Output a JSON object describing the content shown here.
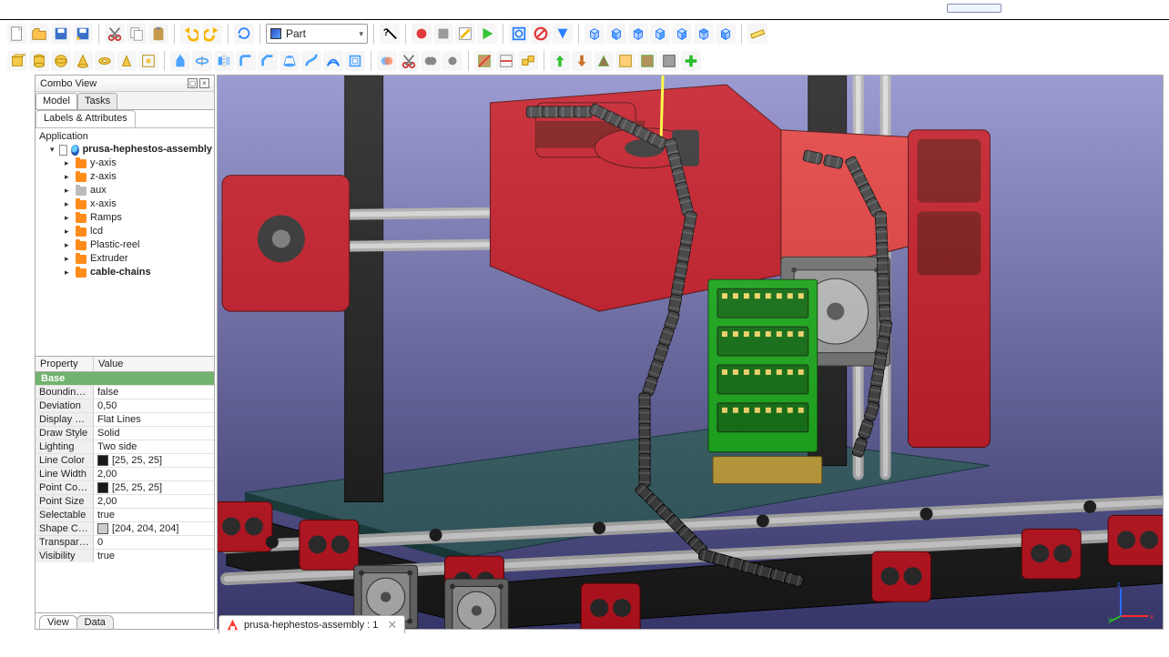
{
  "workbench": {
    "label": "Part"
  },
  "combo_view": {
    "title": "Combo View",
    "tabs": [
      {
        "label": "Model",
        "active": true
      },
      {
        "label": "Tasks",
        "active": false
      }
    ],
    "sub_tabs": [
      {
        "label": "Labels & Attributes",
        "active": true
      }
    ]
  },
  "tree": {
    "root": "Application",
    "document": "prusa-hephestos-assembly",
    "items": [
      {
        "label": "y-axis",
        "kind": "folder"
      },
      {
        "label": "z-axis",
        "kind": "folder"
      },
      {
        "label": "aux",
        "kind": "folder-gray"
      },
      {
        "label": "x-axis",
        "kind": "folder"
      },
      {
        "label": "Ramps",
        "kind": "folder"
      },
      {
        "label": "lcd",
        "kind": "folder"
      },
      {
        "label": "Plastic-reel",
        "kind": "folder"
      },
      {
        "label": "Extruder",
        "kind": "folder"
      },
      {
        "label": "cable-chains",
        "kind": "folder",
        "bold": true
      }
    ]
  },
  "props": {
    "headers": {
      "prop": "Property",
      "val": "Value"
    },
    "group": "Base",
    "rows": [
      {
        "k": "Boundin…",
        "v": "false"
      },
      {
        "k": "Deviation",
        "v": "0,50"
      },
      {
        "k": "Display …",
        "v": "Flat Lines"
      },
      {
        "k": "Draw Style",
        "v": "Solid"
      },
      {
        "k": "Lighting",
        "v": "Two side"
      },
      {
        "k": "Line Color",
        "v": "[25, 25, 25]",
        "swatch": "#191919"
      },
      {
        "k": "Line Width",
        "v": "2,00"
      },
      {
        "k": "Point Co…",
        "v": "[25, 25, 25]",
        "swatch": "#191919"
      },
      {
        "k": "Point Size",
        "v": "2,00"
      },
      {
        "k": "Selectable",
        "v": "true"
      },
      {
        "k": "Shape C…",
        "v": "[204, 204, 204]",
        "swatch": "#cccccc"
      },
      {
        "k": "Transpar…",
        "v": "0"
      },
      {
        "k": "Visibility",
        "v": "true"
      }
    ],
    "footer_tabs": [
      {
        "label": "View",
        "active": true
      },
      {
        "label": "Data",
        "active": false
      }
    ]
  },
  "doc_tab": {
    "label": "prusa-hephestos-assembly : 1"
  },
  "colors": {
    "red": "#c31320",
    "red2": "#e43939",
    "black": "#191919",
    "steel": "#b0b0b0",
    "steel2": "#d9d9d9",
    "dark": "#2f2f2f",
    "pcb": "#14aa14",
    "pcb2": "#0b6d0b",
    "gold": "#c4a238",
    "glass": "#2e5d5d",
    "motor1": "#8d8d8d",
    "motor2": "#565656",
    "chain": "#3b3b3b",
    "yellow": "#fffc30"
  },
  "toolbar": {
    "row1": [
      "new-file",
      "open-file",
      "save-file",
      "save-as-file",
      "|",
      "cut",
      "copy",
      "paste",
      "|",
      "undo",
      "redo",
      "|",
      "refresh",
      "|",
      "_combo_",
      "|",
      "whats-this",
      "|",
      "macro-record",
      "macro-stop",
      "macro-edit",
      "macro-run",
      "|",
      "fit-all",
      "cancel",
      "drop",
      "|",
      "view-iso",
      "view-front",
      "view-top",
      "view-right",
      "view-rear",
      "view-bottom",
      "view-left",
      "|",
      "measure"
    ],
    "row2": [
      "part-box",
      "part-cylinder",
      "part-sphere",
      "part-cone",
      "part-torus",
      "part-prism",
      "part-builder",
      "|",
      "extrude",
      "revolve",
      "mirror",
      "fillet",
      "chamfer",
      "loft",
      "sweep",
      "offset",
      "thickness",
      "|",
      "boolean",
      "cut",
      "fuse",
      "common",
      "|",
      "section",
      "cross",
      "compound",
      "|",
      "import",
      "export",
      "draft",
      "misc1",
      "misc2",
      "misc3",
      "add"
    ]
  }
}
